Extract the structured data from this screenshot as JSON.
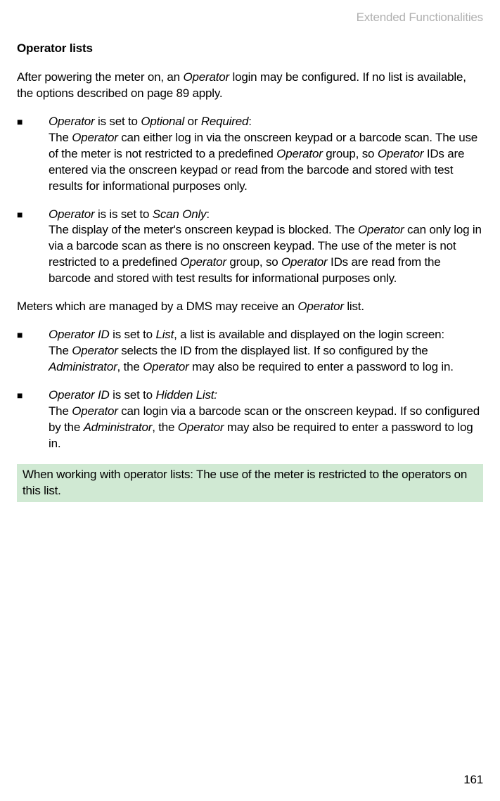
{
  "header": "Extended Functionalities",
  "sectionTitle": "Operator lists",
  "intro": {
    "p1a": "After powering the meter on, an ",
    "p1b": "Operator",
    "p1c": " login may be configured. If no list is available, the options described on page 89 apply."
  },
  "bullets": [
    {
      "l1a": "Operator",
      "l1b": " is set to ",
      "l1c": "Optional",
      "l1d": " or ",
      "l1e": "Required",
      "l1f": ":",
      "l2a": "The ",
      "l2b": "Operator",
      "l2c": " can either log in via the onscreen keypad or a barcode scan. The use of the meter is not restricted to a predefined ",
      "l2d": "Operator",
      "l2e": " group, so ",
      "l2f": "Operator",
      "l2g": " IDs are entered via the onscreen keypad or read from the barcode and stored with test results for informational purposes only."
    },
    {
      "l1a": "Operator",
      "l1b": " is is set to ",
      "l1c": "Scan Only",
      "l1d": ":",
      "l2a": "The display of the meter's  onscreen keypad is  blocked. The ",
      "l2b": "Operator",
      "l2c": " can only log in via a barcode scan as there is no onscreen keypad. The use of the meter is not restricted to a predefined ",
      "l2d": "Operator",
      "l2e": " group, so ",
      "l2f": "Operator",
      "l2g": " IDs are read from the barcode and stored with test results for informational purposes only."
    }
  ],
  "midPara": {
    "a": "Meters which are managed by a DMS may receive an ",
    "b": "Operator",
    "c": " list."
  },
  "bullets2": [
    {
      "l1a": "Operator ID",
      "l1b": " is set to ",
      "l1c": "List",
      "l1d": ", a list is available and displayed on the login screen:",
      "l2a": "The ",
      "l2b": "Operator",
      "l2c": " selects the ID from the displayed list. If so configured by the ",
      "l2d": "Administrator",
      "l2e": ", the ",
      "l2f": "Operator",
      "l2g": " may also be required to enter a password to log in."
    },
    {
      "l1a": "Operator ID",
      "l1b": " is set to ",
      "l1c": "Hidden List:",
      "l2a": "The ",
      "l2b": "Operator",
      "l2c": " can login via a barcode scan or the onscreen keypad. If so configured by the ",
      "l2d": "Administrator",
      "l2e": ",  the ",
      "l2f": "Operator",
      "l2g": " may also be required to enter a password to log in."
    }
  ],
  "note": "When working with operator lists: The use of the meter is restricted to the operators on this list.",
  "pageNumber": "161",
  "bulletChar": "■"
}
